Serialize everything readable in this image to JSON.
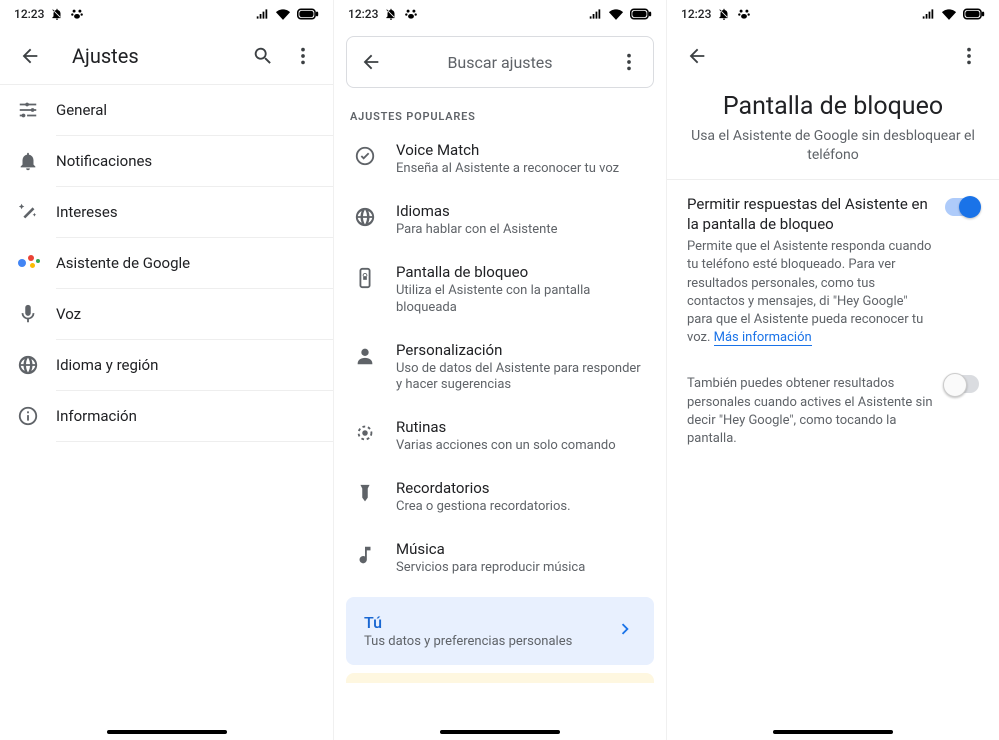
{
  "status": {
    "time": "12:23"
  },
  "screen1": {
    "title": "Ajustes",
    "items": [
      {
        "icon": "tune",
        "label": "General"
      },
      {
        "icon": "bell",
        "label": "Notificaciones"
      },
      {
        "icon": "wand",
        "label": "Intereses"
      },
      {
        "icon": "assistant",
        "label": "Asistente de Google"
      },
      {
        "icon": "mic",
        "label": "Voz"
      },
      {
        "icon": "globe",
        "label": "Idioma y región"
      },
      {
        "icon": "info",
        "label": "Información"
      }
    ]
  },
  "screen2": {
    "search_placeholder": "Buscar ajustes",
    "section_title": "AJUSTES POPULARES",
    "items": [
      {
        "icon": "voicematch",
        "title": "Voice Match",
        "subtitle": "Enseña al Asistente a reconocer tu voz"
      },
      {
        "icon": "globe",
        "title": "Idiomas",
        "subtitle": "Para hablar con el Asistente"
      },
      {
        "icon": "lockphone",
        "title": "Pantalla de bloqueo",
        "subtitle": "Utiliza el Asistente con la pantalla bloqueada"
      },
      {
        "icon": "person",
        "title": "Personalización",
        "subtitle": "Uso de datos del Asistente para responder y hacer sugerencias"
      },
      {
        "icon": "routines",
        "title": "Rutinas",
        "subtitle": "Varias acciones con un solo comando"
      },
      {
        "icon": "reminder",
        "title": "Recordatorios",
        "subtitle": "Crea o gestiona recordatorios."
      },
      {
        "icon": "music",
        "title": "Música",
        "subtitle": "Servicios para reproducir música"
      }
    ],
    "card": {
      "title": "Tú",
      "subtitle": "Tus datos y preferencias personales"
    }
  },
  "screen3": {
    "title": "Pantalla de bloqueo",
    "subtitle": "Usa el Asistente de Google sin desbloquear el teléfono",
    "setting1": {
      "title": "Permitir respuestas del Asistente en la pantalla de bloqueo",
      "desc": "Permite que el Asistente responda cuando tu teléfono esté bloqueado. Para ver resultados personales, como tus contactos y mensajes, di \"Hey Google\" para que el Asistente pueda reconocer tu voz. ",
      "link": "Más información",
      "on": true
    },
    "setting2": {
      "desc": "También puedes obtener resultados personales cuando actives el Asistente sin decir \"Hey Google\", como tocando la pantalla.",
      "on": false
    }
  }
}
